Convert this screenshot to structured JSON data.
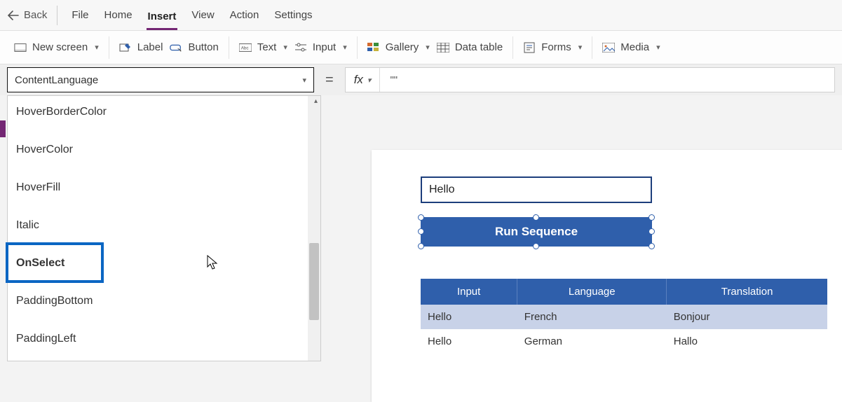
{
  "menubar": {
    "back": "Back",
    "items": [
      "File",
      "Home",
      "Insert",
      "View",
      "Action",
      "Settings"
    ],
    "active_index": 2
  },
  "ribbon": {
    "new_screen": "New screen",
    "label": "Label",
    "button": "Button",
    "text": "Text",
    "input": "Input",
    "gallery": "Gallery",
    "data_table": "Data table",
    "forms": "Forms",
    "media": "Media"
  },
  "formula": {
    "property": "ContentLanguage",
    "fx": "fx",
    "value": "\"\""
  },
  "dropdown_items": [
    {
      "label": "HoverBorderColor",
      "bold": false
    },
    {
      "label": "HoverColor",
      "bold": false
    },
    {
      "label": "HoverFill",
      "bold": false
    },
    {
      "label": "Italic",
      "bold": false
    },
    {
      "label": "OnSelect",
      "bold": true
    },
    {
      "label": "PaddingBottom",
      "bold": false
    },
    {
      "label": "PaddingLeft",
      "bold": false
    }
  ],
  "highlight_target": "OnSelect",
  "canvas": {
    "textinput_value": "Hello",
    "button_label": "Run Sequence",
    "table": {
      "headers": [
        "Input",
        "Language",
        "Translation"
      ],
      "rows": [
        [
          "Hello",
          "French",
          "Bonjour"
        ],
        [
          "Hello",
          "German",
          "Hallo"
        ]
      ]
    }
  },
  "icons": {
    "back": "arrow-left-icon",
    "new_screen": "screen-icon",
    "label": "label-edit-icon",
    "button": "button-icon",
    "text": "text-abc-icon",
    "input": "sliders-icon",
    "gallery": "gallery-grid-icon",
    "data_table": "table-icon",
    "forms": "form-icon",
    "media": "image-icon"
  },
  "colors": {
    "accent": "#742774",
    "primary_blue": "#2f5fab",
    "highlight": "#0b66c3"
  }
}
